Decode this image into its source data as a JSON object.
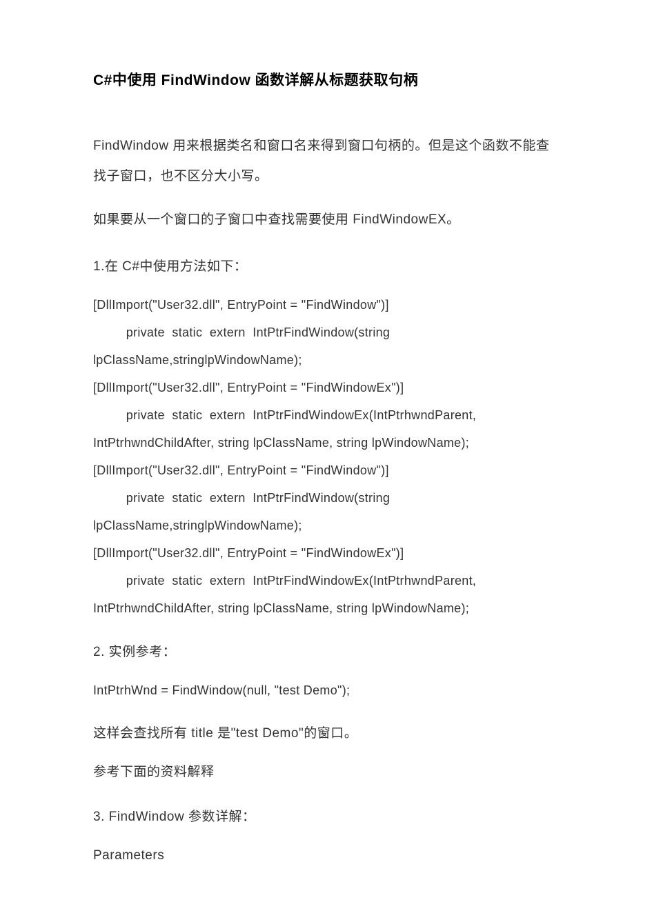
{
  "title": "C#中使用 FindWindow 函数详解从标题获取句柄",
  "intro_p1": "FindWindow 用来根据类名和窗口名来得到窗口句柄的。但是这个函数不能查找子窗口，也不区分大小写。",
  "intro_p2": "如果要从一个窗口的子窗口中查找需要使用 FindWindowEX。",
  "section1": "1.在 C#中使用方法如下：",
  "code1_lines": {
    "l1": "[DllImport(\"User32.dll\",  EntryPoint  =  \"FindWindow\")]",
    "l2": "         private  static  extern  IntPtrFindWindow(string",
    "l3": "lpClassName,stringlpWindowName);",
    "l4": "[DllImport(\"User32.dll\",  EntryPoint  =  \"FindWindowEx\")]",
    "l5": "         private  static  extern  IntPtrFindWindowEx(IntPtrhwndParent,",
    "l6": "IntPtrhwndChildAfter,  string  lpClassName,  string  lpWindowName);",
    "l7": "[DllImport(\"User32.dll\",  EntryPoint  =  \"FindWindow\")]",
    "l8": "         private  static  extern  IntPtrFindWindow(string",
    "l9": "lpClassName,stringlpWindowName);",
    "l10": "[DllImport(\"User32.dll\",  EntryPoint  =  \"FindWindowEx\")]",
    "l11": "         private  static  extern  IntPtrFindWindowEx(IntPtrhwndParent,",
    "l12": "IntPtrhwndChildAfter,  string  lpClassName,  string  lpWindowName);"
  },
  "section2": "2.  实例参考：",
  "code2": "IntPtrhWnd  =  FindWindow(null,  \"test  Demo\");",
  "p_result": "这样会查找所有 title 是\"test  Demo\"的窗口。",
  "p_ref": "参考下面的资料解释",
  "section3": "3.  FindWindow 参数详解：",
  "params_heading": "Parameters"
}
